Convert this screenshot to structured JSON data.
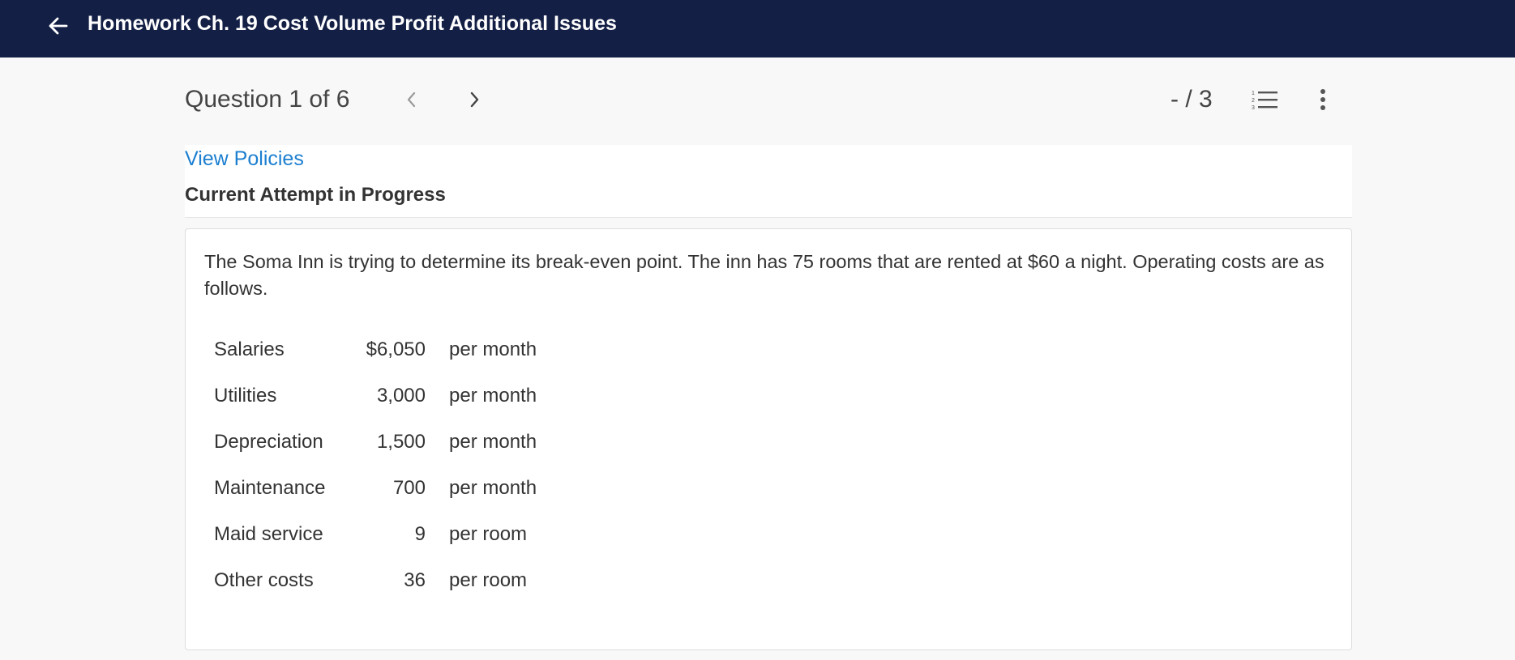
{
  "topbar": {
    "back_icon": "arrow-left-icon",
    "title": "Homework Ch. 19 Cost Volume Profit Additional Issues"
  },
  "question_header": {
    "title": "Question 1 of 6",
    "prev_icon": "chevron-left-icon",
    "next_icon": "chevron-right-icon",
    "score": "- / 3",
    "list_icon": "numbered-list-icon",
    "more_icon": "more-vertical-icon"
  },
  "panel": {
    "policies_link": "View Policies",
    "attempt_status": "Current Attempt in Progress"
  },
  "question": {
    "prompt": "The Soma Inn is trying to determine its break-even point. The inn has 75 rooms that are rented at $60 a night. Operating costs are as follows.",
    "costs": [
      {
        "item": "Salaries",
        "amount": "$6,050",
        "unit": "per month"
      },
      {
        "item": "Utilities",
        "amount": "3,000",
        "unit": "per month"
      },
      {
        "item": "Depreciation",
        "amount": "1,500",
        "unit": "per month"
      },
      {
        "item": "Maintenance",
        "amount": "700",
        "unit": "per month"
      },
      {
        "item": "Maid service",
        "amount": "9",
        "unit": "per room"
      },
      {
        "item": "Other costs",
        "amount": "36",
        "unit": "per room"
      }
    ]
  },
  "colors": {
    "topbar_bg": "#131f45",
    "link": "#1c7fd0",
    "page_bg": "#f8f8f8"
  }
}
